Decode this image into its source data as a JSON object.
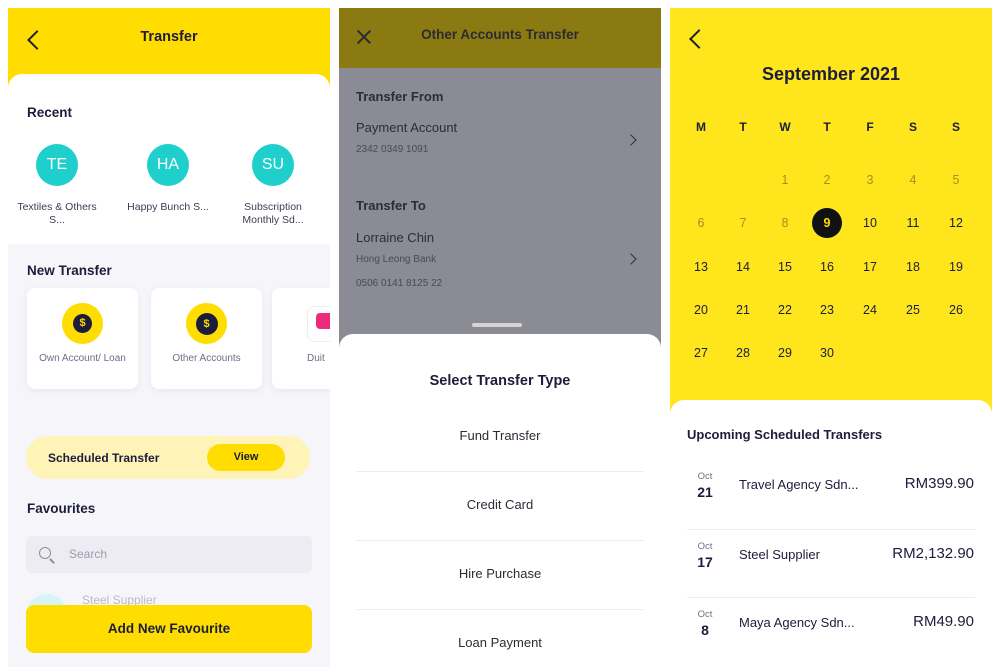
{
  "screen1": {
    "title": "Transfer",
    "recent": {
      "heading": "Recent",
      "items": [
        {
          "initials": "TE",
          "label": "Textiles & Others S..."
        },
        {
          "initials": "HA",
          "label": "Happy Bunch S..."
        },
        {
          "initials": "SU",
          "label": "Subscription Monthly Sd..."
        }
      ]
    },
    "new_transfer": {
      "heading": "New Transfer",
      "tiles": [
        {
          "label": "Own Account/ Loan",
          "icon": "dollar-coin-icon",
          "glyph": "$"
        },
        {
          "label": "Other Accounts",
          "icon": "coins-exchange-icon",
          "glyph": "$"
        },
        {
          "label": "Duit",
          "icon": "duitnow-logo-icon"
        }
      ]
    },
    "scheduled": {
      "label": "Scheduled Transfer",
      "button": "View"
    },
    "favourites": {
      "heading": "Favourites",
      "search_placeholder": "Search",
      "peek_item": "Steel Supplier",
      "add_button": "Add New Favourite"
    },
    "colors": {
      "brand_yellow": "#ffdd00",
      "avatar_teal": "#1fcfcb"
    }
  },
  "screen2": {
    "title": "Other Accounts Transfer",
    "from": {
      "heading": "Transfer From",
      "account": "Payment Account",
      "number": "2342 0349 1091"
    },
    "to": {
      "heading": "Transfer To",
      "name": "Lorraine Chin",
      "bank": "Hong Leong Bank",
      "number": "0506 0141 8125 22"
    },
    "sheet": {
      "title": "Select Transfer Type",
      "options": [
        "Fund Transfer",
        "Credit Card",
        "Hire Purchase",
        "Loan Payment"
      ]
    }
  },
  "screen3": {
    "month": "September 2021",
    "weekdays": [
      "M",
      "T",
      "W",
      "T",
      "F",
      "S",
      "S"
    ],
    "selected_day": 9,
    "weeks": [
      [
        "",
        "",
        "1",
        "2",
        "3",
        "4",
        "5"
      ],
      [
        "6",
        "7",
        "8",
        "9",
        "10",
        "11",
        "12"
      ],
      [
        "13",
        "14",
        "15",
        "16",
        "17",
        "18",
        "19"
      ],
      [
        "20",
        "21",
        "22",
        "23",
        "24",
        "25",
        "26"
      ],
      [
        "27",
        "28",
        "29",
        "30",
        "",
        "",
        ""
      ]
    ],
    "upcoming": {
      "heading": "Upcoming Scheduled Transfers",
      "items": [
        {
          "month": "Oct",
          "day": "21",
          "name": "Travel Agency Sdn...",
          "amount": "RM399.90"
        },
        {
          "month": "Oct",
          "day": "17",
          "name": "Steel Supplier",
          "amount": "RM2,132.90"
        },
        {
          "month": "Oct",
          "day": "8",
          "name": "Maya Agency Sdn...",
          "amount": "RM49.90"
        }
      ]
    }
  }
}
